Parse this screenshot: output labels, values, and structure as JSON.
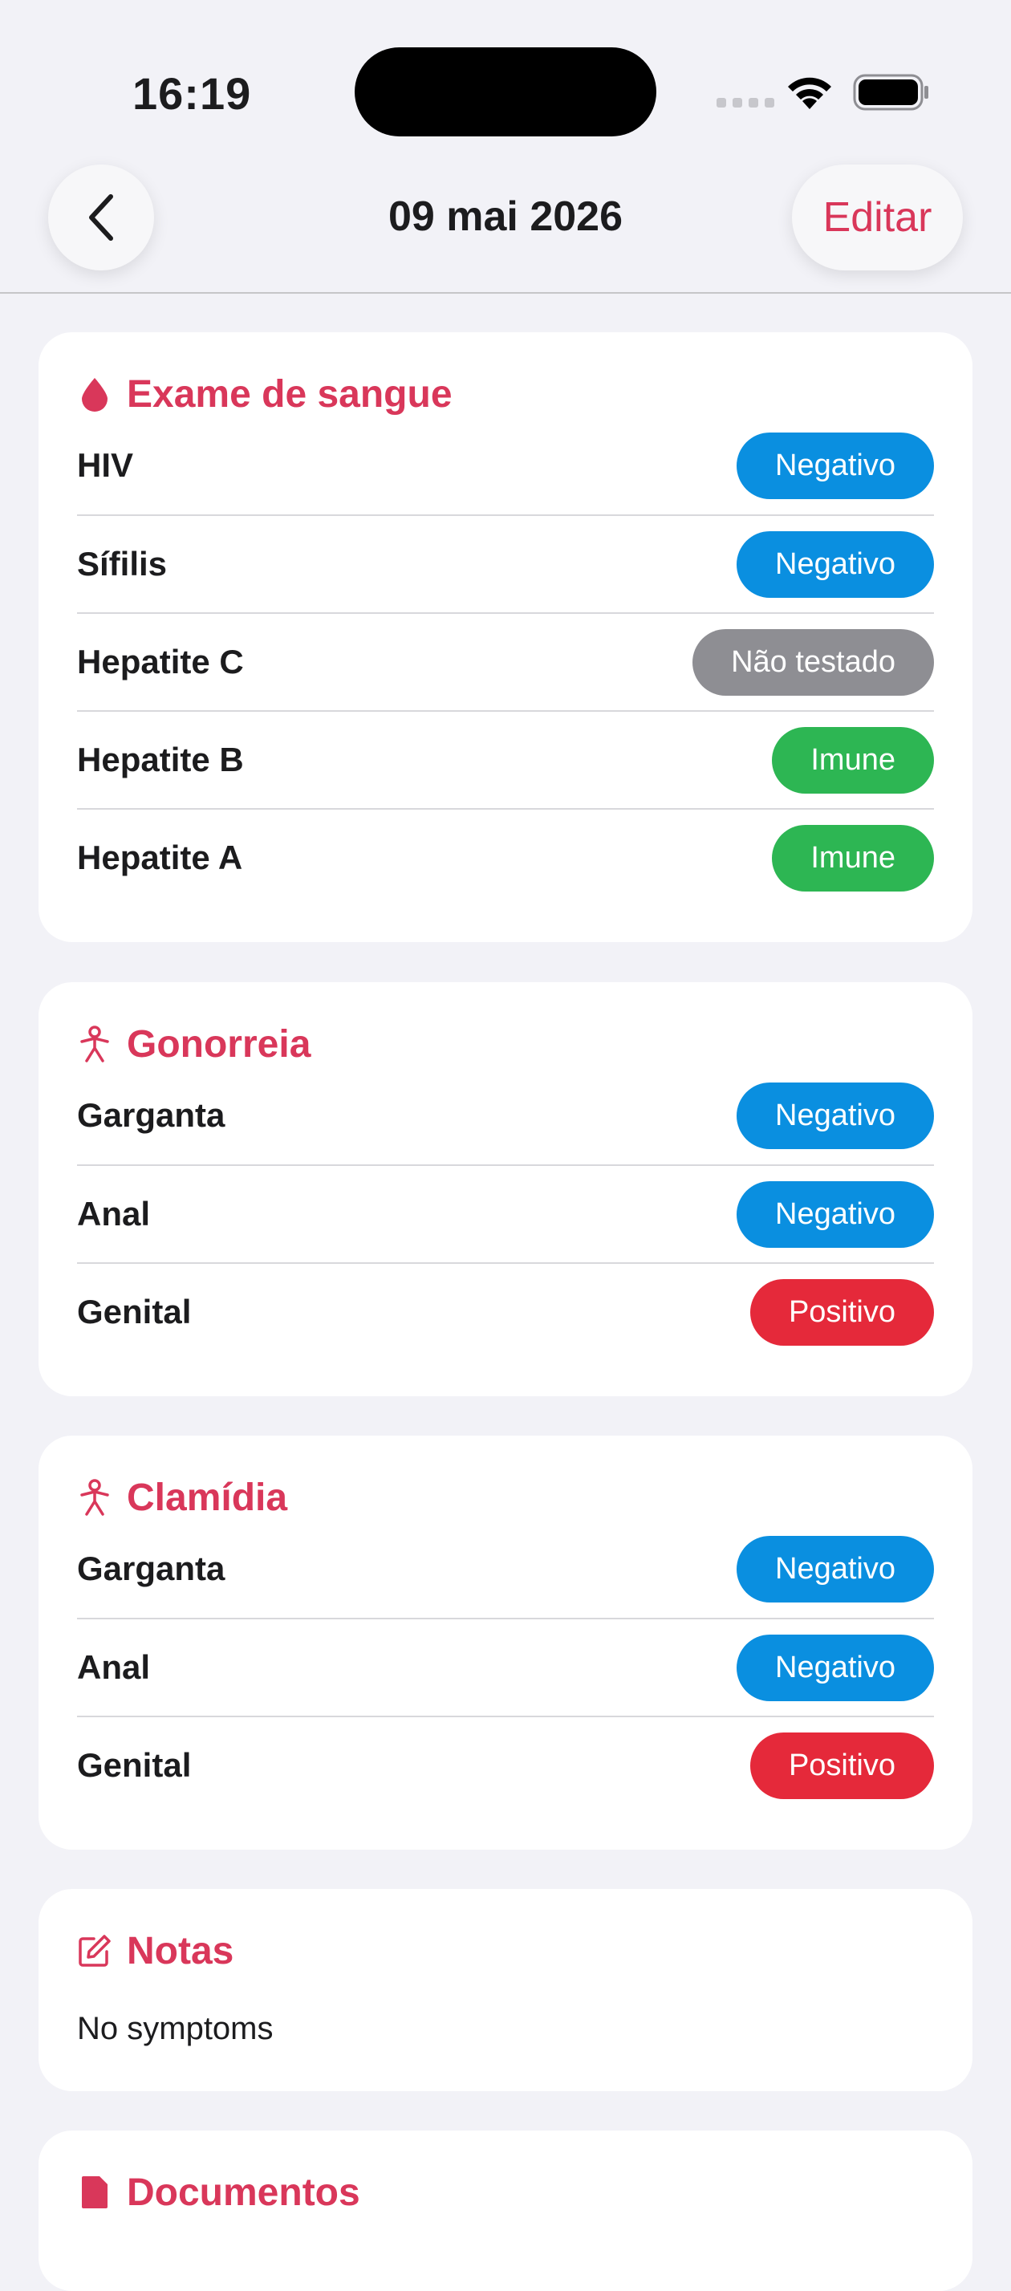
{
  "status_bar": {
    "time": "16:19"
  },
  "nav": {
    "title": "09 mai 2026",
    "edit_label": "Editar"
  },
  "colors": {
    "accent": "#D9375A",
    "negativo": "#0A8FE0",
    "positivo": "#E5293A",
    "imune": "#2DB653",
    "nao_testado": "#8E8E93"
  },
  "sections": [
    {
      "title": "Exame de sangue",
      "icon": "blood-drop-icon",
      "rows": [
        {
          "label": "HIV",
          "result": "Negativo",
          "status": "negativo"
        },
        {
          "label": "Sífilis",
          "result": "Negativo",
          "status": "negativo"
        },
        {
          "label": "Hepatite C",
          "result": "Não testado",
          "status": "nao_testado"
        },
        {
          "label": "Hepatite B",
          "result": "Imune",
          "status": "imune"
        },
        {
          "label": "Hepatite A",
          "result": "Imune",
          "status": "imune"
        }
      ]
    },
    {
      "title": "Gonorreia",
      "icon": "person-icon",
      "rows": [
        {
          "label": "Garganta",
          "result": "Negativo",
          "status": "negativo"
        },
        {
          "label": "Anal",
          "result": "Negativo",
          "status": "negativo"
        },
        {
          "label": "Genital",
          "result": "Positivo",
          "status": "positivo"
        }
      ]
    },
    {
      "title": "Clamídia",
      "icon": "person-icon",
      "rows": [
        {
          "label": "Garganta",
          "result": "Negativo",
          "status": "negativo"
        },
        {
          "label": "Anal",
          "result": "Negativo",
          "status": "negativo"
        },
        {
          "label": "Genital",
          "result": "Positivo",
          "status": "positivo"
        }
      ]
    }
  ],
  "notes": {
    "title": "Notas",
    "icon": "edit-note-icon",
    "text": "No symptoms"
  },
  "documents": {
    "title": "Documentos",
    "icon": "document-icon"
  }
}
